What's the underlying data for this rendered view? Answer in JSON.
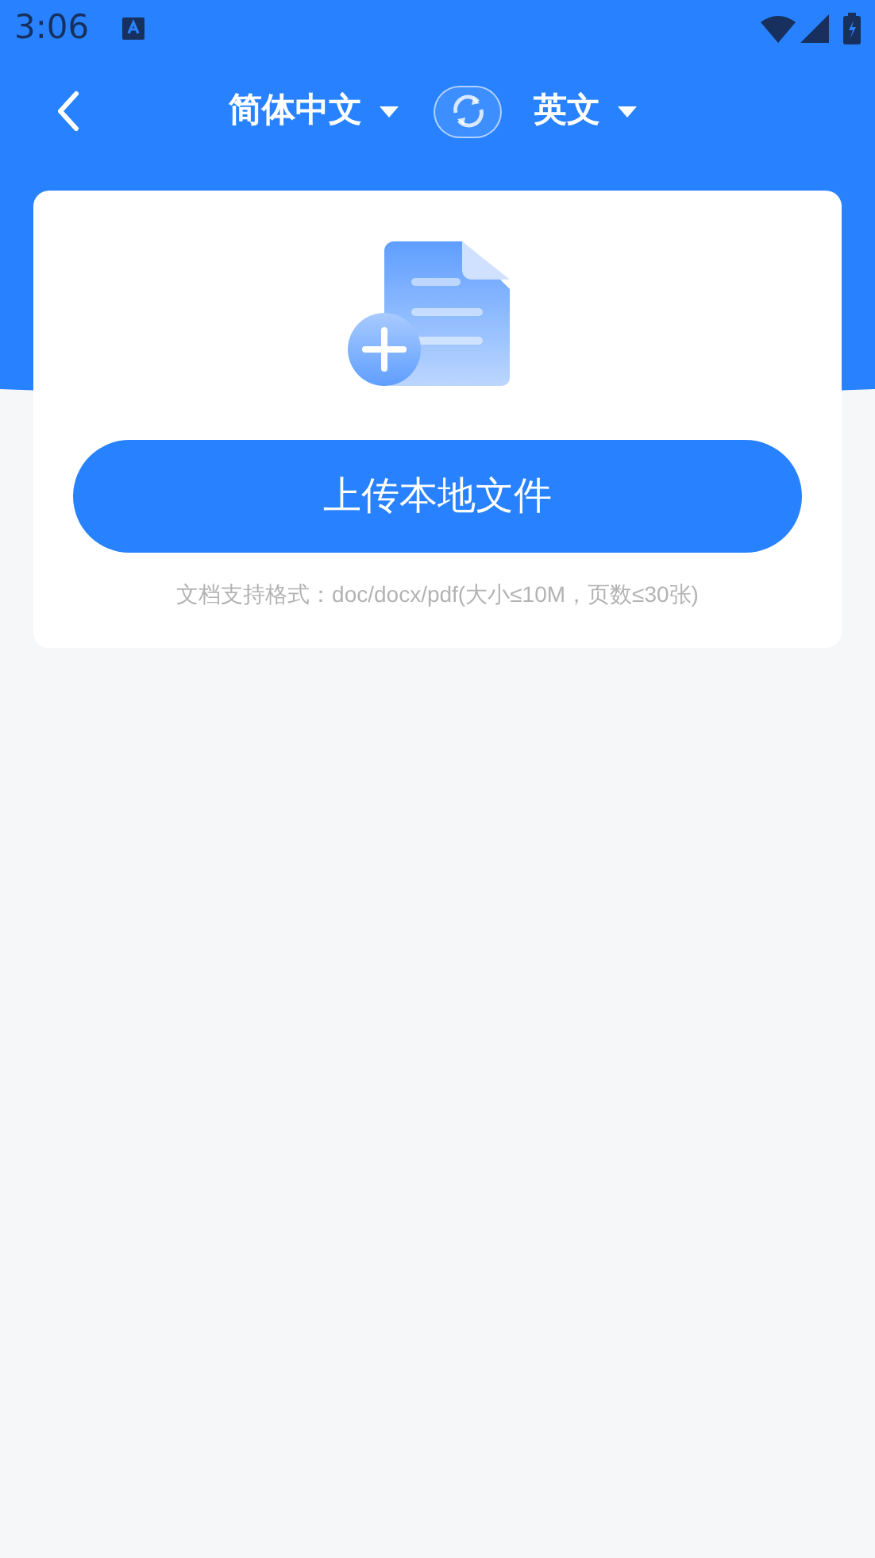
{
  "status_bar": {
    "time": "3:06"
  },
  "nav": {
    "source_language": "简体中文",
    "target_language": "英文"
  },
  "upload": {
    "button": "上传本地文件",
    "hint": "文档支持格式：doc/docx/pdf(大小≤10M，页数≤30张)"
  }
}
